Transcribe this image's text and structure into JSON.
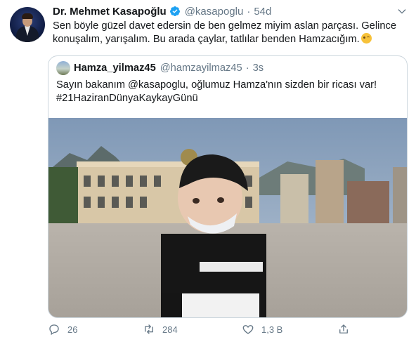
{
  "tweet": {
    "author_name": "Dr. Mehmet Kasapoğlu",
    "author_handle": "@kasapoglu",
    "separator": "·",
    "time": "54d",
    "text": "Sen böyle güzel davet edersin de ben gelmez miyim aslan parçası. Gelince konuşalım, yarışalım. Bu arada çaylar, tatlılar benden Hamzacığım.",
    "emoji": "winking-face"
  },
  "quoted": {
    "author_name": "Hamza_yilmaz45",
    "author_handle": "@hamzayilmaz45",
    "separator": "·",
    "time": "3s",
    "text_line1": "Sayın bakanım @kasapoglu, oğlumuz Hamza'nın sizden bir ricası var!",
    "text_line2": "#21HaziranDünyaKaykayGünü",
    "media": "video-still"
  },
  "actions": {
    "reply_count": "26",
    "retweet_count": "284",
    "like_count": "1,3 B"
  },
  "icons": [
    "verified-badge-icon",
    "chevron-down-icon",
    "reply-icon",
    "retweet-icon",
    "like-icon",
    "share-icon"
  ],
  "colors": {
    "text": "#14171a",
    "secondary": "#657786",
    "verified": "#1da1f2",
    "border": "#ccd6dd"
  }
}
